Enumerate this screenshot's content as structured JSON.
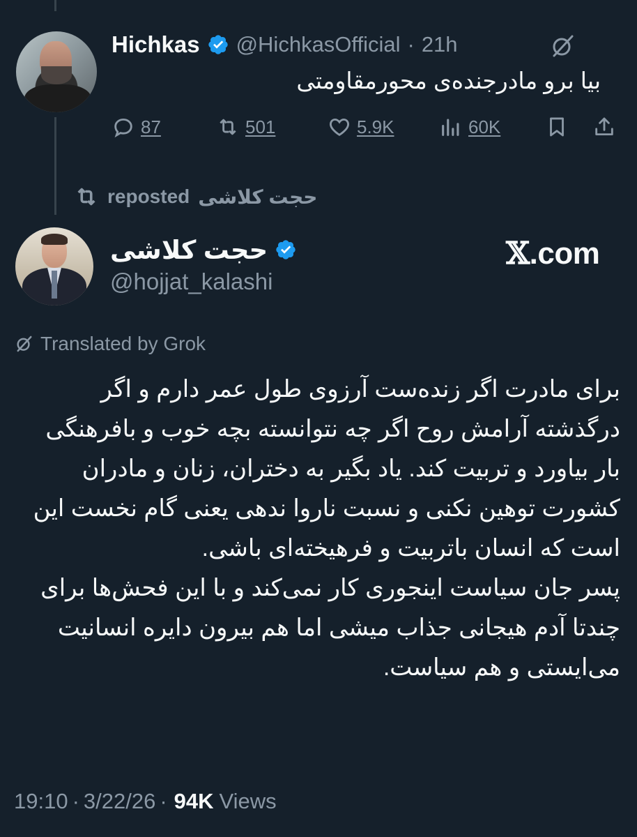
{
  "parent_tweet": {
    "display_name": "Hichkas",
    "handle": "@HichkasOfficial",
    "separator": "·",
    "time": "21h",
    "text": "بیا برو مادرجنده‌ی محورمقاومتی",
    "actions": {
      "replies": "87",
      "reposts": "501",
      "likes": "5.9K",
      "views": "60K"
    },
    "avatar_icon": "user-photo",
    "verified_icon": "verified-badge-icon",
    "translate_icon": "grok-translate-icon"
  },
  "repost_banner": {
    "reposter": "حجت کلاشی",
    "label": "reposted",
    "icon": "repost-icon"
  },
  "main_tweet": {
    "display_name": "حجت کلاشی",
    "handle": "@hojjat_kalashi",
    "watermark_x": "𝕏",
    "watermark_rest": ".com",
    "translated_label": "Translated by Grok",
    "paragraph_1": "برای مادرت اگر زنده‌ست آرزوی طول عمر دارم و اگر درگذشته آرامش روح اگر چه نتوانسته بچه خوب و بافرهنگی بار بیاورد و تربیت کند. یاد بگیر به دختران، زنان و مادران کشورت توهین نکنی و نسبت ناروا ندهی یعنی گام نخست این است که انسان باتربیت و فرهیخته‌ای باشی.",
    "paragraph_2": "پسر جان سیاست اینجوری کار نمی‌کند و با این فحش‌ها برای چندتا آدم هیجانی جذاب میشی اما هم بیرون دایره انسانیت می‌ایستی و هم سیاست.",
    "time": "19:10",
    "date": "3/22/26",
    "separator": "·",
    "views_count": "94K",
    "views_label": "Views"
  },
  "colors": {
    "background": "#15202b",
    "text": "#f7f9f9",
    "muted": "#8b98a5",
    "verified": "#1d9bf0",
    "thread_line": "#38444d"
  }
}
